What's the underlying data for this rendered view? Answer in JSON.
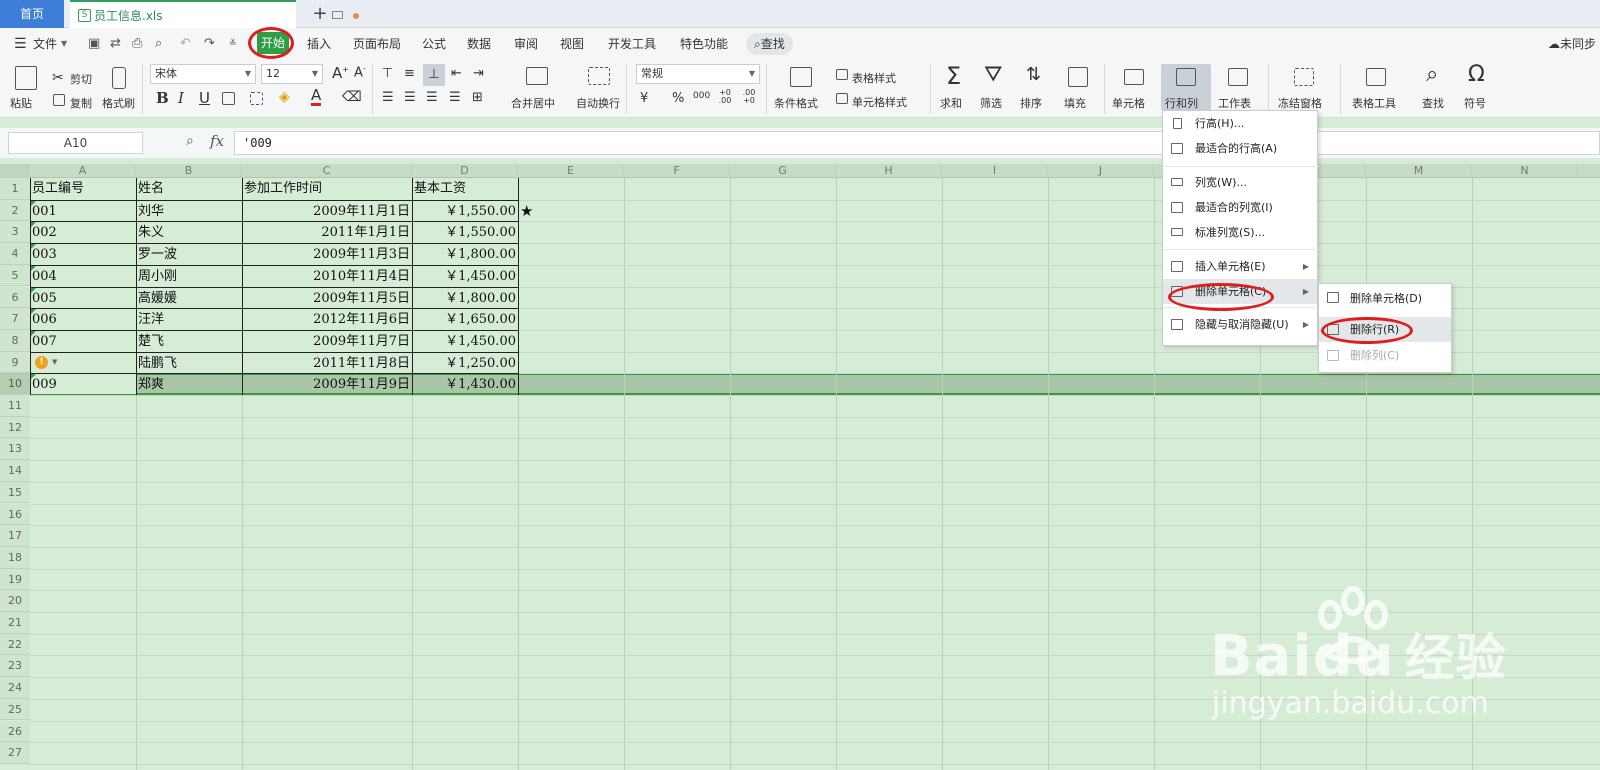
{
  "tabs": {
    "home": "首页",
    "file": "员工信息.xls",
    "add": "+"
  },
  "menubar": {
    "file": "文件",
    "items": [
      "开始",
      "插入",
      "页面布局",
      "公式",
      "数据",
      "审阅",
      "视图",
      "开发工具",
      "特色功能"
    ],
    "search": "查找",
    "sync": "未同步"
  },
  "ribbon": {
    "paste": "粘贴",
    "cut": "剪切",
    "copy": "复制",
    "format_painter": "格式刷",
    "font": "宋体",
    "font_size": "12",
    "merge_center": "合并居中",
    "wrap_text": "自动换行",
    "number_format": "常规",
    "currency": "¥",
    "percent": "%",
    "thousands": "000",
    "inc_decimal": "+0 .00",
    "dec_decimal": ".00 +0",
    "cond_format": "条件格式",
    "table_style": "表格样式",
    "cell_style": "单元格样式",
    "sum": "求和",
    "filter": "筛选",
    "sort": "排序",
    "fill": "填充",
    "cell": "单元格",
    "row_col": "行和列",
    "worksheet": "工作表",
    "freeze": "冻结窗格",
    "table_tools": "表格工具",
    "find": "查找",
    "symbol": "符号"
  },
  "formula_bar": {
    "name_box": "A10",
    "fx": "fx",
    "value": "'009"
  },
  "columns": [
    "A",
    "B",
    "C",
    "D",
    "E",
    "F",
    "G",
    "H",
    "I",
    "J",
    "K",
    "L",
    "M",
    "N"
  ],
  "rows": [
    "1",
    "2",
    "3",
    "4",
    "5",
    "6",
    "7",
    "8",
    "9",
    "10",
    "11",
    "12",
    "13",
    "14",
    "15",
    "16",
    "17",
    "18",
    "19",
    "20",
    "21",
    "22",
    "23",
    "24",
    "25",
    "26",
    "27"
  ],
  "table": {
    "headers": [
      "员工编号",
      "姓名",
      "参加工作时间",
      "基本工资"
    ],
    "data": [
      [
        "001",
        "刘华",
        "2009年11月1日",
        "￥1,550.00"
      ],
      [
        "002",
        "朱义",
        "2011年1月1日",
        "￥1,550.00"
      ],
      [
        "003",
        "罗一波",
        "2009年11月3日",
        "￥1,800.00"
      ],
      [
        "004",
        "周小刚",
        "2010年11月4日",
        "￥1,450.00"
      ],
      [
        "005",
        "高媛媛",
        "2009年11月5日",
        "￥1,800.00"
      ],
      [
        "006",
        "汪洋",
        "2012年11月6日",
        "￥1,650.00"
      ],
      [
        "007",
        "楚飞",
        "2009年11月7日",
        "￥1,450.00"
      ],
      [
        "",
        "陆鹏飞",
        "2011年11月8日",
        "￥1,250.00"
      ],
      [
        "009",
        "郑爽",
        "2009年11月9日",
        "￥1,430.00"
      ]
    ],
    "star": "★"
  },
  "row_col_menu": {
    "items": [
      "行高(H)...",
      "最适合的行高(A)",
      "列宽(W)...",
      "最适合的列宽(I)",
      "标准列宽(S)...",
      "插入单元格(E)",
      "删除单元格(C)",
      "隐藏与取消隐藏(U)"
    ]
  },
  "delete_submenu": {
    "items": [
      "删除单元格(D)",
      "删除行(R)",
      "删除列(C)"
    ]
  },
  "watermark": {
    "logo": "Bai",
    "logo2": "du",
    "brand": "经验",
    "url": "jingyan.baidu.com"
  }
}
